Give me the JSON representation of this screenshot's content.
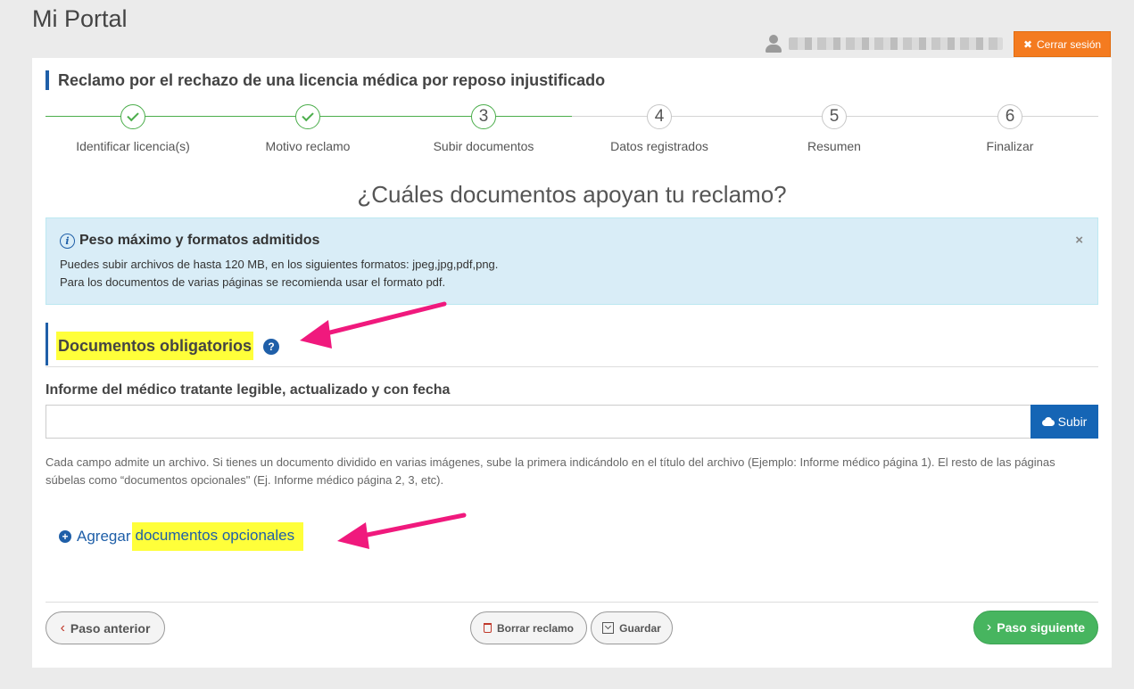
{
  "portal": {
    "title": "Mi Portal"
  },
  "user": {
    "logout_label": "Cerrar sesión"
  },
  "claim": {
    "title": "Reclamo por el rechazo de una licencia médica por reposo injustificado"
  },
  "steps": [
    {
      "number": "1",
      "label": "Identificar licencia(s)",
      "state": "done"
    },
    {
      "number": "2",
      "label": "Motivo reclamo",
      "state": "done"
    },
    {
      "number": "3",
      "label": "Subir documentos",
      "state": "current"
    },
    {
      "number": "4",
      "label": "Datos registrados",
      "state": "todo"
    },
    {
      "number": "5",
      "label": "Resumen",
      "state": "todo"
    },
    {
      "number": "6",
      "label": "Finalizar",
      "state": "todo"
    }
  ],
  "question": "¿Cuáles documentos apoyan tu reclamo?",
  "alert": {
    "title": "Peso máximo y formatos admitidos",
    "line1": "Puedes subir archivos de hasta 120 MB, en los siguientes formatos: jpeg,jpg,pdf,png.",
    "line2": "Para los documentos de varias páginas se recomienda usar el formato pdf.",
    "close": "×"
  },
  "section": {
    "title": "Documentos obligatorios",
    "help": "?"
  },
  "field": {
    "label": "Informe del médico tratante legible, actualizado y con fecha",
    "value": "",
    "upload_label": "Subir"
  },
  "help_text": "Cada campo admite un archivo. Si tienes un documento dividido en varias imágenes, sube la primera indicándolo en el título del archivo (Ejemplo: Informe médico página 1). El resto de las páginas súbelas como “documentos opcionales\" (Ej. Informe médico página 2, 3, etc).",
  "add_optional": {
    "prefix": "Agregar",
    "highlight": "documentos opcionales"
  },
  "footer": {
    "prev_label": "Paso anterior",
    "delete_label": "Borrar reclamo",
    "save_label": "Guardar",
    "next_label": "Paso siguiente"
  },
  "colors": {
    "accent_blue": "#1f5fa8",
    "success_green": "#47b55f",
    "logout_orange": "#f47b20",
    "highlight_yellow": "#ffff3a",
    "annotation_pink": "#f0197d"
  }
}
